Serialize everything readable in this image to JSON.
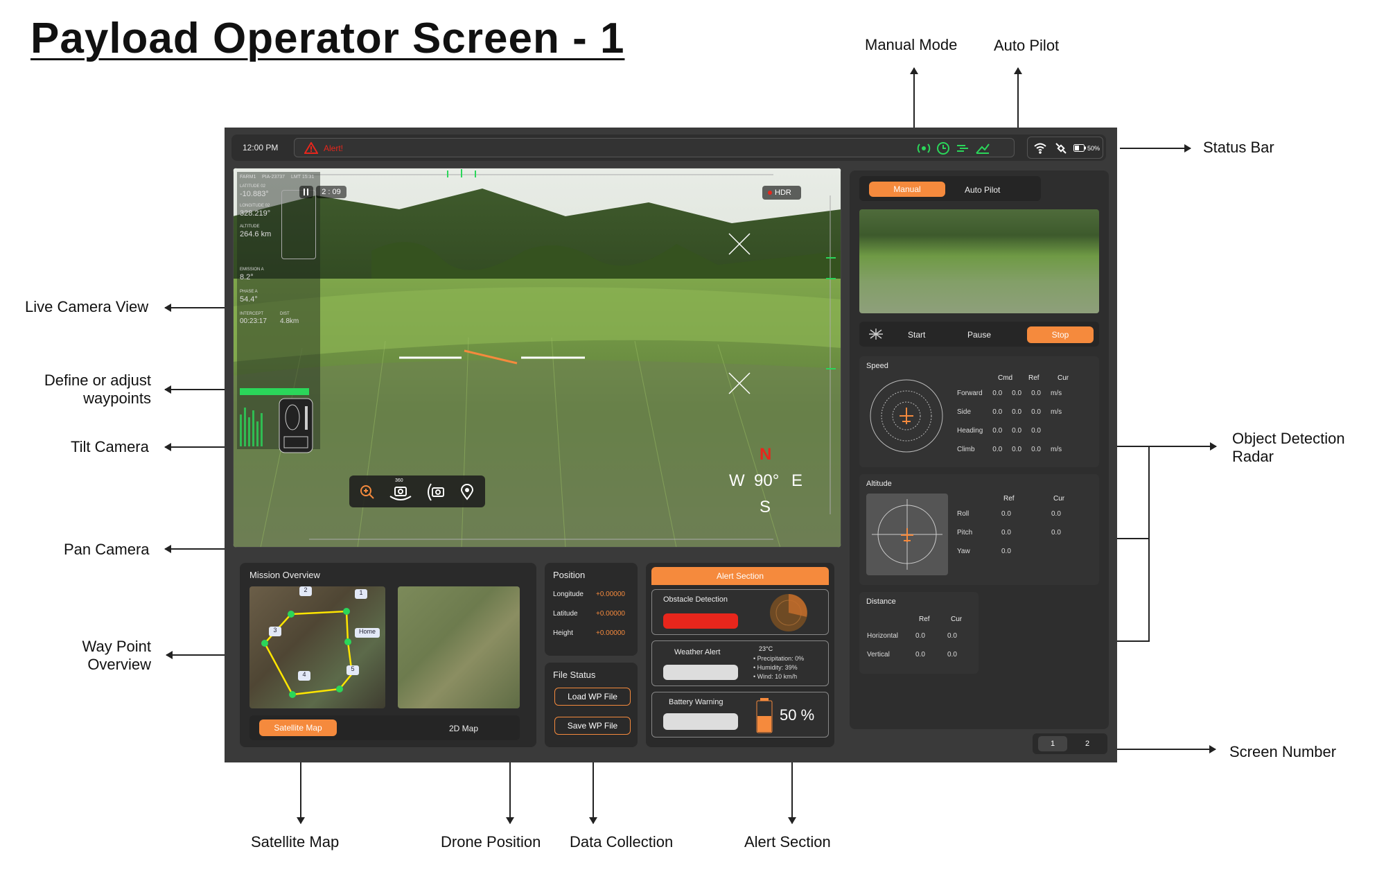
{
  "page_title": "Payload Operator Screen - 1",
  "annotations": {
    "manual_mode": "Manual Mode",
    "auto_pilot": "Auto Pilot",
    "status_bar": "Status Bar",
    "live_camera_view": "Live Camera View",
    "define_waypoints_1": "Define or adjust",
    "define_waypoints_2": "waypoints",
    "tilt_camera": "Tilt Camera",
    "pan_camera": "Pan Camera",
    "way_point_overview_1": "Way Point",
    "way_point_overview_2": "Overview",
    "object_detection_radar_1": "Object Detection",
    "object_detection_radar_2": "Radar",
    "screen_number": "Screen Number",
    "satellite_map": "Satellite Map",
    "drone_position": "Drone Position",
    "data_collection": "Data Collection",
    "alert_section": "Alert Section"
  },
  "status_bar": {
    "time": "12:00 PM",
    "alert": "Alert!",
    "battery": "50%"
  },
  "camera": {
    "timer": "2 : 09",
    "hdr": "HDR",
    "compass_n": "N",
    "compass_w": "W",
    "compass_heading": "90°",
    "compass_e": "E",
    "compass_s": "S",
    "hud_id": "PIA-23737",
    "hud_lmt": "LMT 15:31",
    "hud_farm": "FARM1",
    "latitude_label": "LATITUDE 02",
    "latitude": "-10.883°",
    "longitude_label": "LONGITUDE 02",
    "longitude": "328.219°",
    "altitude_label": "ALTITUDE",
    "altitude": "264.6 km",
    "emission_label": "EMISSION A",
    "emission": "8.2°",
    "phase_label": "PHASE A",
    "phase": "54.4°",
    "intercept_label": "INTERCEPT",
    "intercept": "00:23:17",
    "dist_label": "DIST",
    "dist": "4.8km",
    "zoom_360": "360"
  },
  "mode": {
    "manual": "Manual",
    "auto_pilot": "Auto Pilot"
  },
  "controls": {
    "start": "Start",
    "pause": "Pause",
    "stop": "Stop"
  },
  "speed": {
    "title": "Speed",
    "headers": [
      "Cmd",
      "Ref",
      "Cur"
    ],
    "rows": [
      {
        "label": "Forward",
        "cmd": "0.0",
        "ref": "0.0",
        "cur": "0.0",
        "unit": "m/s"
      },
      {
        "label": "Side",
        "cmd": "0.0",
        "ref": "0.0",
        "cur": "0.0",
        "unit": "m/s"
      },
      {
        "label": "Heading",
        "cmd": "0.0",
        "ref": "0.0",
        "cur": "0.0",
        "unit": ""
      },
      {
        "label": "Climb",
        "cmd": "0.0",
        "ref": "0.0",
        "cur": "0.0",
        "unit": "m/s"
      }
    ]
  },
  "altitude": {
    "title": "Altitude",
    "headers": [
      "Ref",
      "Cur"
    ],
    "rows": [
      {
        "label": "Roll",
        "ref": "0.0",
        "cur": "0.0"
      },
      {
        "label": "Pitch",
        "ref": "0.0",
        "cur": "0.0"
      },
      {
        "label": "Yaw",
        "ref": "0.0",
        "cur": ""
      }
    ]
  },
  "distance": {
    "title": "Distance",
    "headers": [
      "Ref",
      "Cur"
    ],
    "rows": [
      {
        "label": "Horizontal",
        "ref": "0.0",
        "cur": "0.0"
      },
      {
        "label": "Vertical",
        "ref": "0.0",
        "cur": "0.0"
      }
    ]
  },
  "mission": {
    "title": "Mission Overview",
    "waypoints": [
      "1",
      "2",
      "3",
      "4",
      "5"
    ],
    "home": "Home",
    "satellite_map": "Satellite Map",
    "map_2d": "2D Map"
  },
  "position": {
    "title": "Position",
    "rows": [
      {
        "label": "Longitude",
        "value": "+0.00000"
      },
      {
        "label": "Latitude",
        "value": "+0.00000"
      },
      {
        "label": "Height",
        "value": "+0.00000"
      }
    ]
  },
  "file_status": {
    "title": "File Status",
    "load": "Load WP File",
    "save": "Save WP File"
  },
  "alerts": {
    "title": "Alert Section",
    "obstacle": "Obstacle Detection",
    "weather": "Weather Alert",
    "temp": "23°C",
    "precip": "• Precipitation: 0%",
    "humidity": "• Humidity: 39%",
    "wind": "• Wind: 10 km/h",
    "battery": "Battery Warning",
    "battery_pct": "50 %"
  },
  "screen_numbers": [
    "1",
    "2"
  ],
  "colors": {
    "accent": "#f58a3d",
    "danger": "#e8261c",
    "ok": "#2bd65a",
    "bg": "#3a3a3a"
  }
}
